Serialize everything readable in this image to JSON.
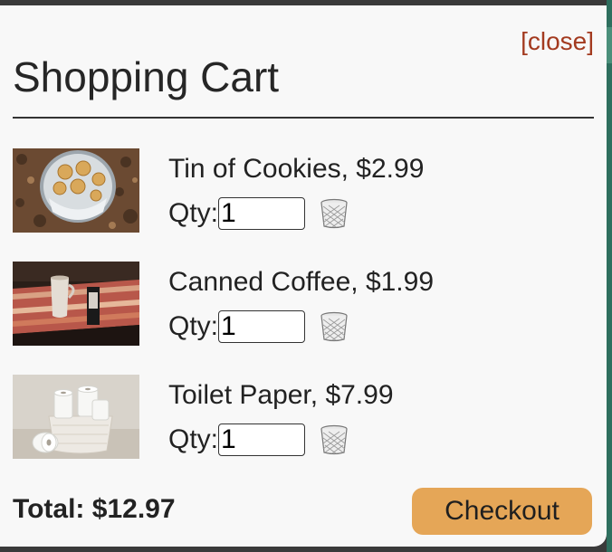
{
  "modal": {
    "close_label": "[close]",
    "title": "Shopping Cart"
  },
  "items": [
    {
      "name_price": "Tin of Cookies, $2.99",
      "qty_label": "Qty:",
      "qty_value": "1",
      "image": "cookies-tin-photo"
    },
    {
      "name_price": "Canned Coffee, $1.99",
      "qty_label": "Qty:",
      "qty_value": "1",
      "image": "canned-coffee-photo"
    },
    {
      "name_price": "Toilet Paper, $7.99",
      "qty_label": "Qty:",
      "qty_value": "1",
      "image": "toilet-paper-photo"
    }
  ],
  "footer": {
    "total_text": "Total: $12.97",
    "checkout_label": "Checkout"
  },
  "colors": {
    "close_link": "#a33a1f",
    "checkout_button": "#e5a657",
    "modal_background": "#f8f8f8"
  }
}
